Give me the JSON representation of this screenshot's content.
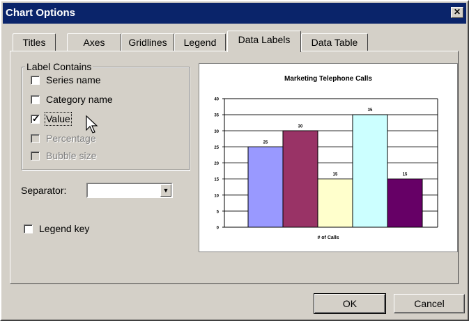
{
  "window": {
    "title": "Chart Options",
    "close_glyph": "✕"
  },
  "tabs": [
    {
      "label": "Titles"
    },
    {
      "label": "Axes"
    },
    {
      "label": "Gridlines"
    },
    {
      "label": "Legend"
    },
    {
      "label": "Data Labels",
      "active": true
    },
    {
      "label": "Data Table"
    }
  ],
  "label_contains": {
    "group_label": "Label Contains",
    "options": [
      {
        "label": "Series name",
        "checked": false,
        "enabled": true
      },
      {
        "label": "Category name",
        "checked": false,
        "enabled": true
      },
      {
        "label": "Value",
        "checked": true,
        "enabled": true
      },
      {
        "label": "Percentage",
        "checked": false,
        "enabled": false
      },
      {
        "label": "Bubble size",
        "checked": false,
        "enabled": false
      }
    ]
  },
  "separator": {
    "label": "Separator:",
    "value": ""
  },
  "legend_key": {
    "label": "Legend key",
    "checked": false
  },
  "buttons": {
    "ok": "OK",
    "cancel": "Cancel"
  },
  "chart_data": {
    "type": "bar",
    "title": "Marketing Telephone Calls",
    "xlabel": "# of Calls",
    "ylabel": "",
    "ylim": [
      0,
      40
    ],
    "yticks": [
      0,
      5,
      10,
      15,
      20,
      25,
      30,
      35,
      40
    ],
    "categories": [
      "",
      "",
      "",
      "",
      ""
    ],
    "values": [
      25,
      30,
      15,
      35,
      15
    ],
    "data_labels": [
      "25",
      "30",
      "15",
      "35",
      "15"
    ],
    "colors": [
      "#9999ff",
      "#993366",
      "#ffffcc",
      "#ccffff",
      "#660066"
    ],
    "grid": true,
    "legend": "none"
  }
}
